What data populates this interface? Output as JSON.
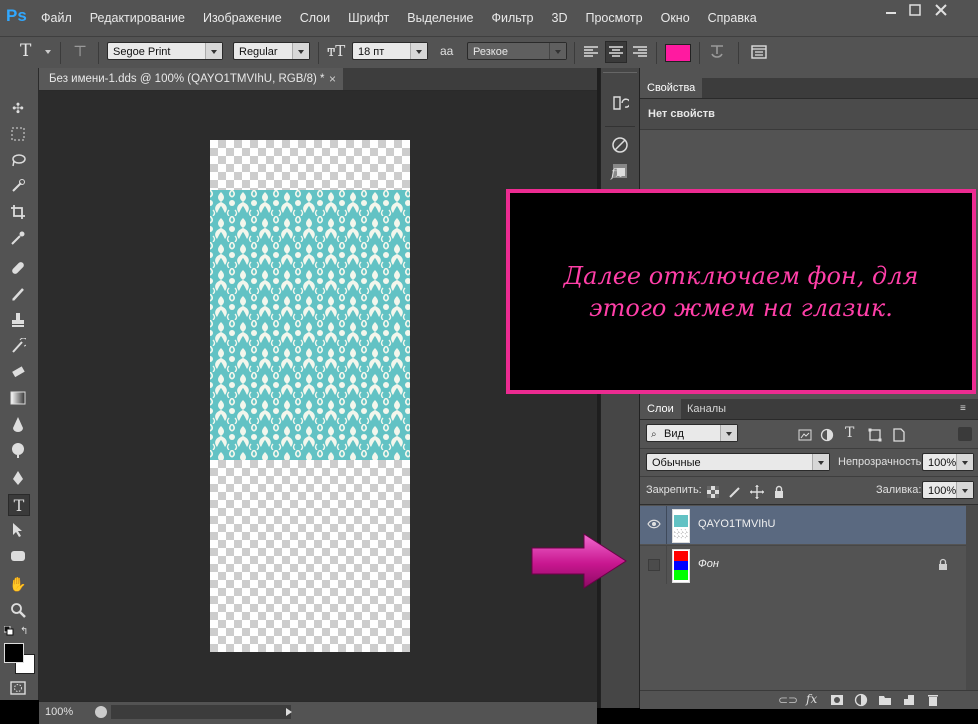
{
  "app": {
    "logo": "Ps"
  },
  "menu": [
    "Файл",
    "Редактирование",
    "Изображение",
    "Слои",
    "Шрифт",
    "Выделение",
    "Фильтр",
    "3D",
    "Просмотр",
    "Окно",
    "Справка"
  ],
  "options": {
    "font_family": "Segoe Print",
    "font_style": "Regular",
    "font_size": "18 пт",
    "antialias_label": "aa",
    "antialias": "Резкое",
    "color": "#ff1aa0"
  },
  "document": {
    "tab_title": "Без имени-1.dds @ 100% (QAYO1TMVIhU, RGB/8) *",
    "close_glyph": "×",
    "zoom": "100%"
  },
  "properties_panel": {
    "tab": "Свойства",
    "empty_text": "Нет свойств"
  },
  "callout": {
    "text": "Далее отключаем фон, для этого жмем на глазик.",
    "border_color": "#ec2b91",
    "text_color": "#ff3fa8"
  },
  "layers_panel": {
    "tabs": [
      "Слои",
      "Каналы"
    ],
    "filter": "Вид",
    "blend_mode": "Обычные",
    "opacity_label": "Непрозрачность:",
    "opacity": "100%",
    "lock_label": "Закрепить:",
    "fill_label": "Заливка:",
    "fill": "100%",
    "layers": [
      {
        "name": "QAYO1TMVIhU",
        "visible": true,
        "selected": true
      },
      {
        "name": "Фон",
        "visible": false,
        "selected": false,
        "locked": true
      }
    ]
  }
}
